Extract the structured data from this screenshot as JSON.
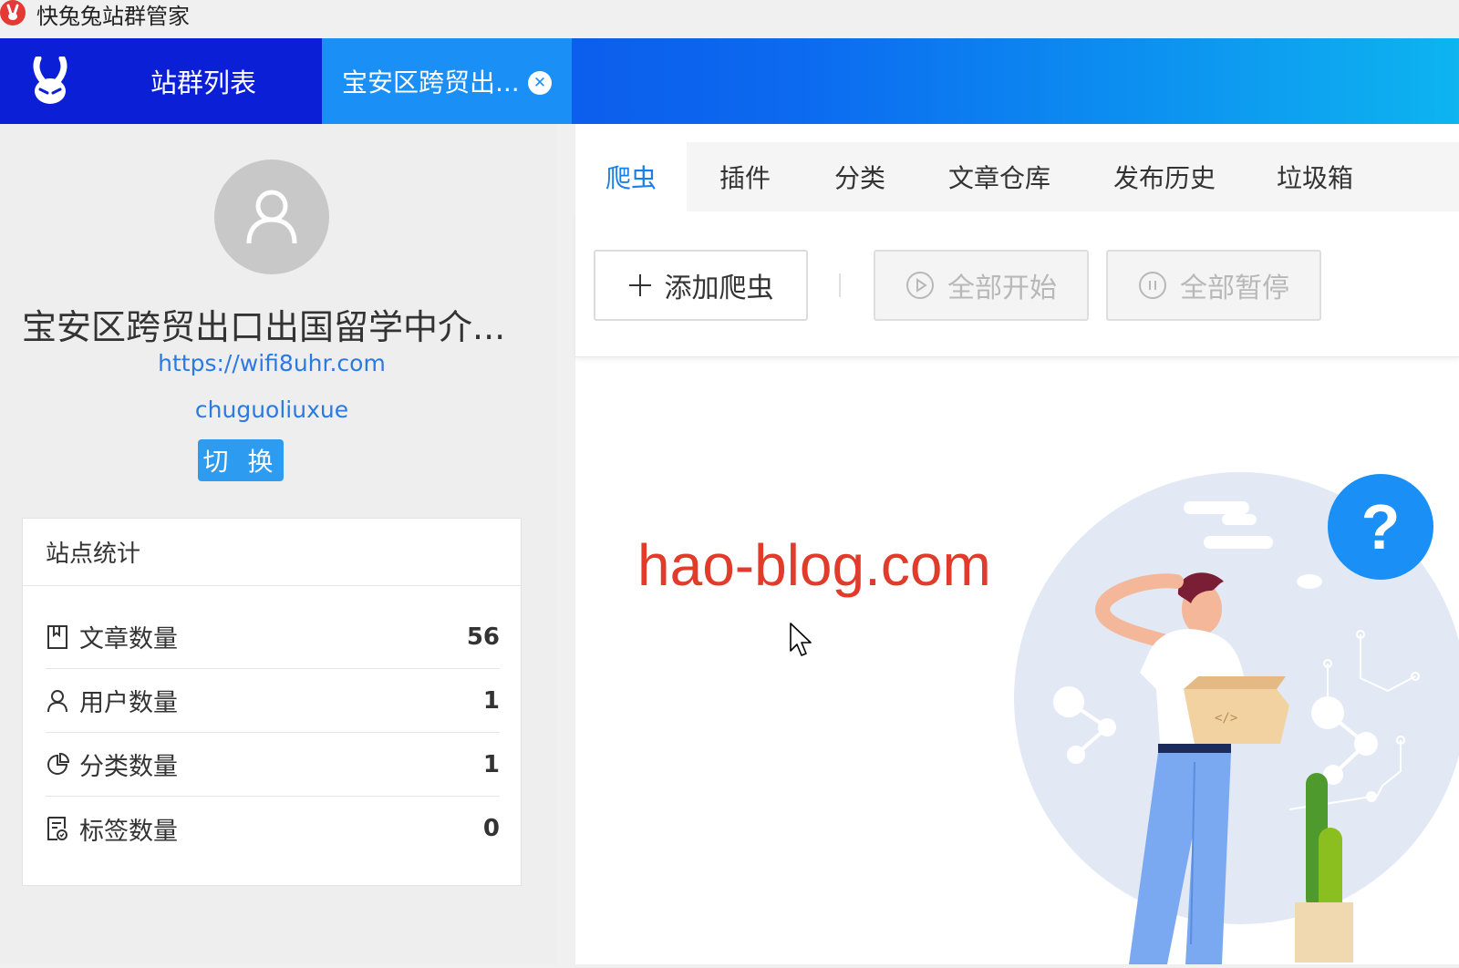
{
  "window": {
    "title": "快兔兔站群管家"
  },
  "topnav": {
    "site_list_label": "站群列表",
    "active_tab_label": "宝安区跨贸出..."
  },
  "site": {
    "name": "宝安区跨贸出口出国留学中介...",
    "url": "https://wifi8uhr.com",
    "user": "chuguoliuxue",
    "switch_label": "切 换"
  },
  "stats": {
    "title": "站点统计",
    "rows": [
      {
        "label": "文章数量",
        "value": "56",
        "icon": "book-icon"
      },
      {
        "label": "用户数量",
        "value": "1",
        "icon": "user-icon"
      },
      {
        "label": "分类数量",
        "value": "1",
        "icon": "pie-chart-icon"
      },
      {
        "label": "标签数量",
        "value": "0",
        "icon": "tag-document-icon"
      }
    ]
  },
  "tabs": [
    "爬虫",
    "插件",
    "分类",
    "文章仓库",
    "发布历史",
    "垃圾箱"
  ],
  "toolbar": {
    "add_label": "添加爬虫",
    "start_all_label": "全部开始",
    "pause_all_label": "全部暂停"
  },
  "watermark": "hao-blog.com",
  "help_label": "?",
  "colors": {
    "nav_dark": "#0a1fd6",
    "nav_active": "#1a8ff5",
    "link": "#2a7ae2",
    "accent_tab": "#1a7fe8",
    "watermark": "#e13b2b"
  }
}
